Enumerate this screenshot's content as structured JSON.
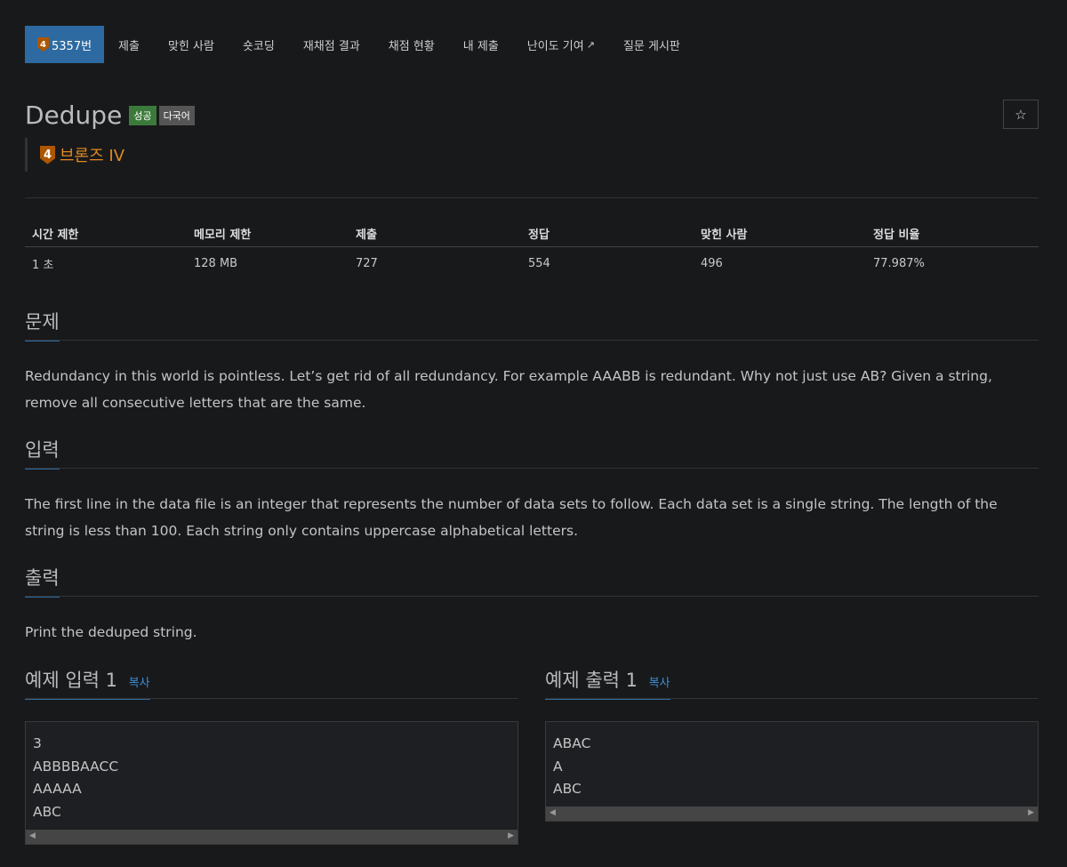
{
  "nav": {
    "problem_number": "5357번",
    "tier_digit": "4",
    "items": [
      "제출",
      "맞힌 사람",
      "숏코딩",
      "재채점 결과",
      "채점 현황",
      "내 제출",
      "난이도 기여",
      "질문 게시판"
    ]
  },
  "problem": {
    "title": "Dedupe",
    "label_success": "성공",
    "label_multilang": "다국어",
    "tier": "브론즈 IV",
    "tier_digit": "4",
    "star": "☆"
  },
  "info": {
    "headers": [
      "시간 제한",
      "메모리 제한",
      "제출",
      "정답",
      "맞힌 사람",
      "정답 비율"
    ],
    "values": [
      "1 초",
      "128 MB",
      "727",
      "554",
      "496",
      "77.987%"
    ]
  },
  "sections": {
    "problem_title": "문제",
    "problem_text": "Redundancy in this world is pointless. Let’s get rid of all redundancy. For example AAABB is redundant. Why not just use AB? Given a string, remove all consecutive letters that are the same.",
    "input_title": "입력",
    "input_text": "The first line in the data file is an integer that represents the number of data sets to follow. Each data set is a single string. The length of the string is less than 100. Each string only contains uppercase alphabetical letters.",
    "output_title": "출력",
    "output_text": "Print the deduped string."
  },
  "samples": {
    "input_title": "예제 입력 1",
    "output_title": "예제 출력 1",
    "copy": "복사",
    "input": "3\nABBBBAACC\nAAAAA\nABC",
    "output": "ABAC\nA\nABC"
  },
  "colors": {
    "accent": "#2d6aa1",
    "tier_bronze": "#ad5600",
    "tier_text": "#e38a22",
    "success": "#3c7a3b"
  }
}
